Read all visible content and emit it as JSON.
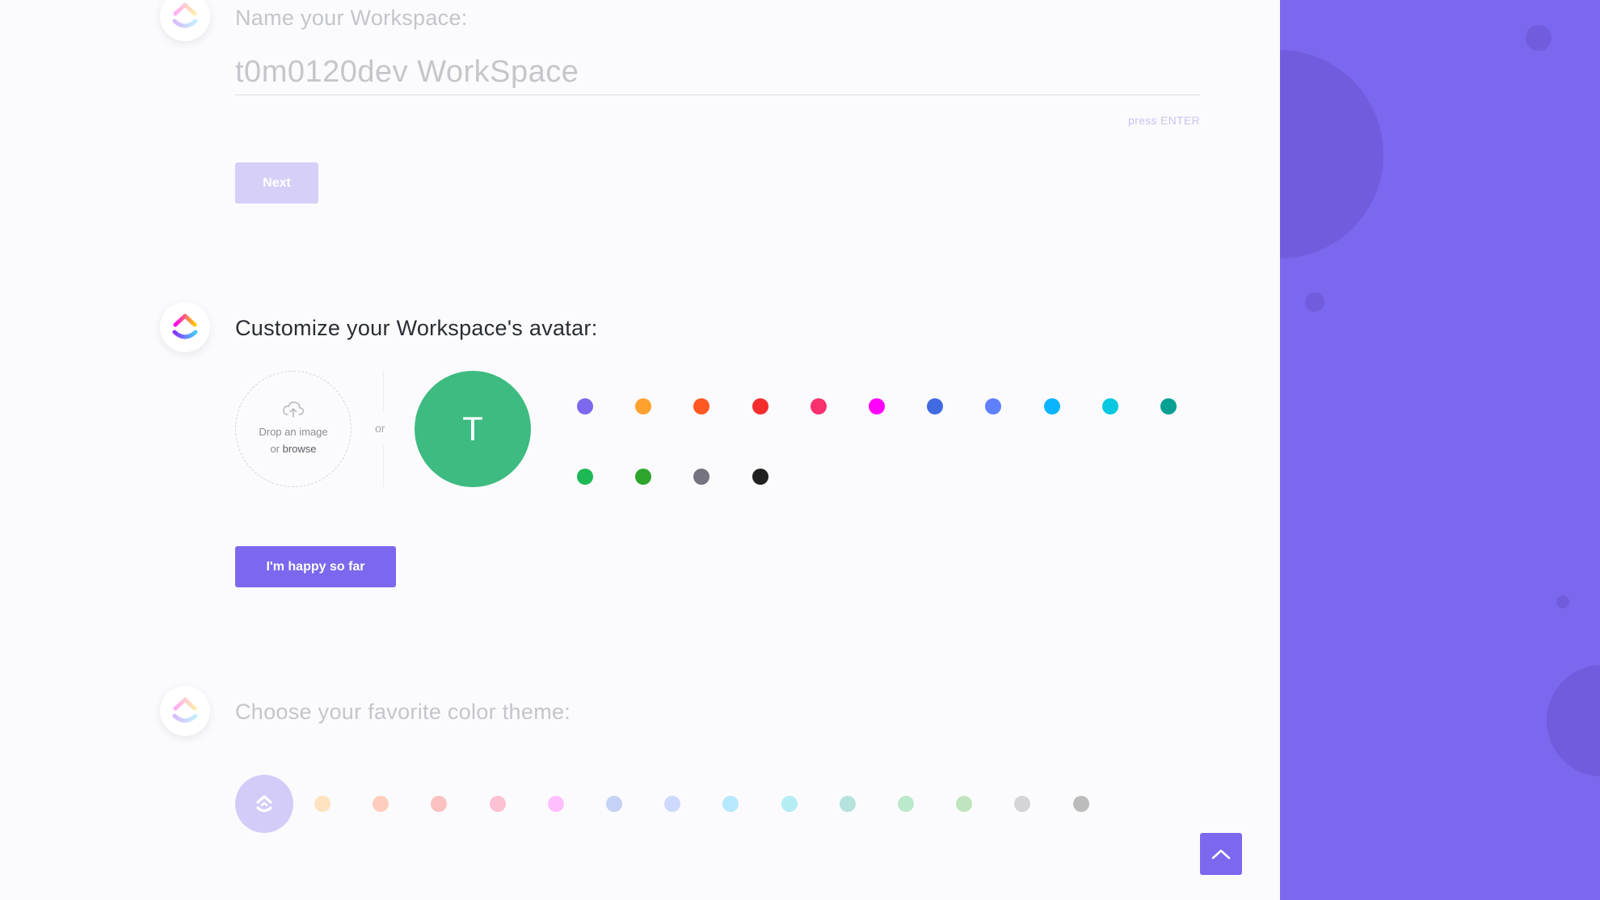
{
  "step_name": {
    "heading": "Name your Workspace:",
    "input_value": "t0m0120dev WorkSpace",
    "hint": "press ENTER",
    "next_label": "Next"
  },
  "step_avatar": {
    "heading": "Customize your Workspace's avatar:",
    "drop_text": "Drop an image",
    "drop_or": "or",
    "drop_browse": "browse",
    "or_label": "or",
    "avatar_letter": "T",
    "avatar_color": "#3dbb80",
    "colors": [
      "#7b68ee",
      "#ffa12f",
      "#ff5722",
      "#f42c2c",
      "#f8306d",
      "#ff00fc",
      "#4169e1",
      "#5f81ff",
      "#0ab4ff",
      "#08c7e0",
      "#07a092",
      "#1db954",
      "#2ea52c",
      "#757380",
      "#202020"
    ],
    "confirm_label": "I'm happy so far"
  },
  "step_theme": {
    "heading": "Choose your favorite color theme:",
    "selected_color": "#d3ccf8",
    "colors": [
      "#ffe2c0",
      "#ffcdbc",
      "#fbc0c0",
      "#fcc1d3",
      "#ffbffe",
      "#c6d1f6",
      "#cfd9ff",
      "#b6e8ff",
      "#b5edf5",
      "#b5e2dc",
      "#bbe9cb",
      "#c0e4c0",
      "#d5d5d9",
      "#bcbcbc"
    ]
  },
  "scroll_top": {
    "icon": "chevron-up-icon"
  },
  "brand_colors": {
    "accent": "#7b68ee"
  }
}
